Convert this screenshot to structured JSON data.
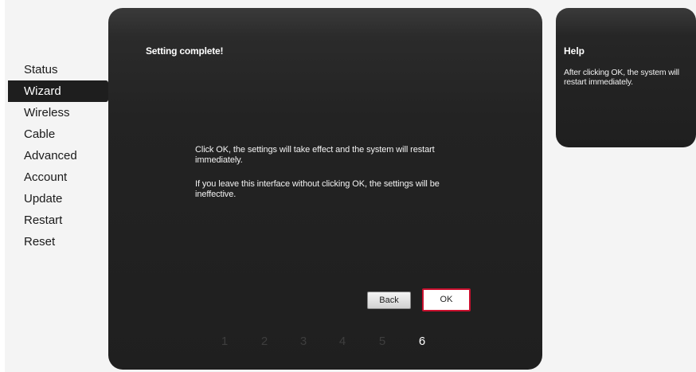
{
  "sidebar": {
    "items": [
      {
        "label": "Status"
      },
      {
        "label": "Wizard"
      },
      {
        "label": "Wireless"
      },
      {
        "label": "Cable"
      },
      {
        "label": "Advanced"
      },
      {
        "label": "Account"
      },
      {
        "label": "Update"
      },
      {
        "label": "Restart"
      },
      {
        "label": "Reset"
      }
    ],
    "active": "Wizard"
  },
  "main": {
    "title": "Setting complete!",
    "message1": "Click OK, the settings will take effect and the system will restart immediately.",
    "message2": "If you leave this interface without clicking OK, the settings will be ineffective.",
    "back_label": "Back",
    "ok_label": "OK",
    "steps": [
      "1",
      "2",
      "3",
      "4",
      "5",
      "6"
    ],
    "current_step": "6"
  },
  "help": {
    "title": "Help",
    "text": "After clicking OK, the system will restart immediately."
  },
  "colors": {
    "accent": "#c8102e",
    "panel": "#1f1f1f",
    "active_nav": "#1e1e1e"
  }
}
